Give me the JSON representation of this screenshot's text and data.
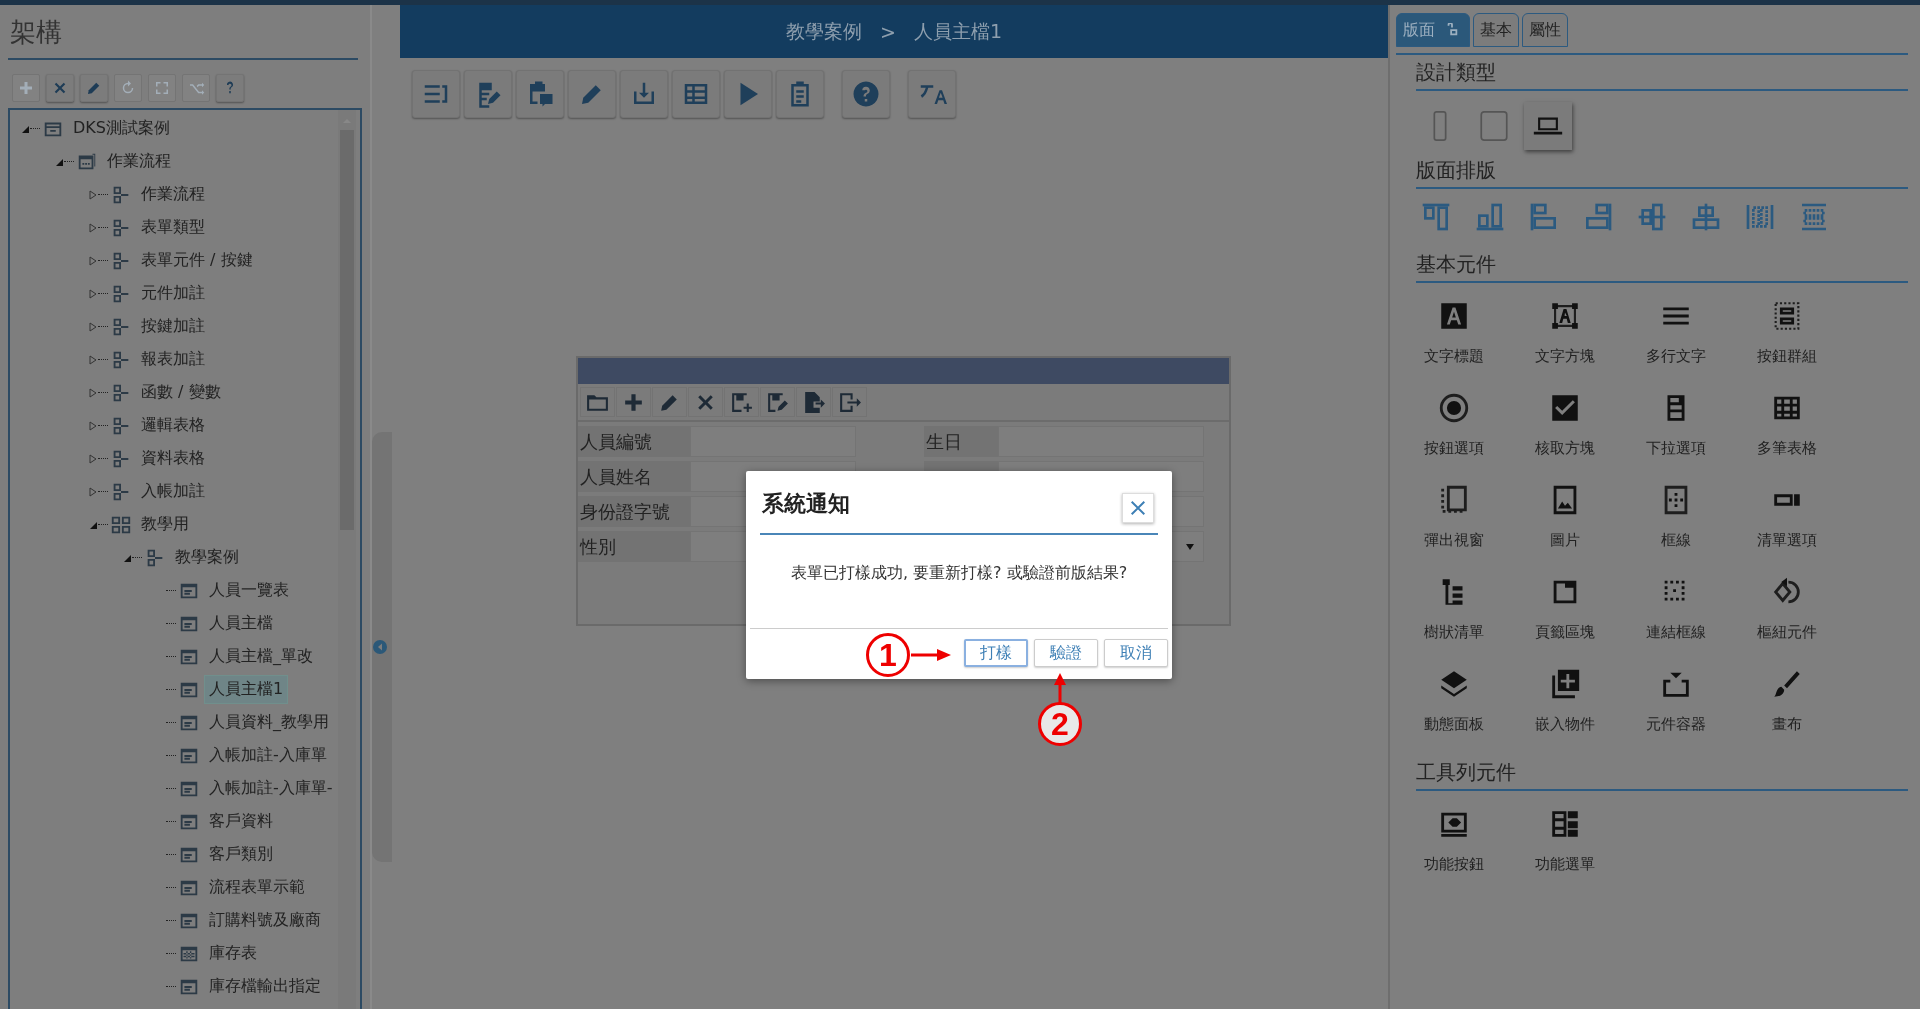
{
  "left_panel": {
    "title": "架構",
    "toolbar": [
      {
        "kind": "add",
        "disabled": true
      },
      {
        "kind": "delete",
        "disabled": false
      },
      {
        "kind": "edit",
        "disabled": false
      },
      {
        "kind": "refresh",
        "disabled": true
      },
      {
        "kind": "expand",
        "disabled": true
      },
      {
        "kind": "shuffle",
        "disabled": true
      },
      {
        "kind": "help",
        "disabled": false
      }
    ],
    "tree": [
      {
        "label": "DKS測試案例",
        "kind": "root",
        "expanded": true,
        "selected": false,
        "children": [
          {
            "label": "作業流程",
            "kind": "flow",
            "expanded": true,
            "selected": false,
            "children": [
              {
                "label": "作業流程",
                "kind": "node",
                "expanded": false,
                "selected": false
              },
              {
                "label": "表單類型",
                "kind": "node",
                "expanded": false,
                "selected": false
              },
              {
                "label": "表單元件 / 按鍵",
                "kind": "node",
                "expanded": false,
                "selected": false
              },
              {
                "label": "元件加註",
                "kind": "node",
                "expanded": false,
                "selected": false
              },
              {
                "label": "按鍵加註",
                "kind": "node",
                "expanded": false,
                "selected": false
              },
              {
                "label": "報表加註",
                "kind": "node",
                "expanded": false,
                "selected": false
              },
              {
                "label": "函數 / 變數",
                "kind": "node",
                "expanded": false,
                "selected": false
              },
              {
                "label": "邏輯表格",
                "kind": "node",
                "expanded": false,
                "selected": false
              },
              {
                "label": "資料表格",
                "kind": "node",
                "expanded": false,
                "selected": false
              },
              {
                "label": "入帳加註",
                "kind": "node",
                "expanded": false,
                "selected": false
              },
              {
                "label": "教學用",
                "kind": "group",
                "expanded": true,
                "selected": false,
                "children": [
                  {
                    "label": "教學案例",
                    "kind": "node",
                    "expanded": true,
                    "selected": false,
                    "children": [
                      {
                        "label": "人員一覽表",
                        "kind": "form",
                        "selected": false
                      },
                      {
                        "label": "人員主檔",
                        "kind": "form",
                        "selected": false
                      },
                      {
                        "label": "人員主檔_單改",
                        "kind": "form",
                        "selected": false
                      },
                      {
                        "label": "人員主檔1",
                        "kind": "form",
                        "selected": true
                      },
                      {
                        "label": "人員資料_教學用",
                        "kind": "form",
                        "selected": false
                      },
                      {
                        "label": "入帳加註-入庫單",
                        "kind": "form",
                        "selected": false
                      },
                      {
                        "label": "入帳加註-入庫單-",
                        "kind": "form",
                        "selected": false
                      },
                      {
                        "label": "客戶資料",
                        "kind": "form",
                        "selected": false
                      },
                      {
                        "label": "客戶類別",
                        "kind": "form",
                        "selected": false
                      },
                      {
                        "label": "流程表單示範",
                        "kind": "form",
                        "selected": false
                      },
                      {
                        "label": "訂購料號及廠商",
                        "kind": "form",
                        "selected": false
                      },
                      {
                        "label": "庫存表",
                        "kind": "table",
                        "selected": false
                      },
                      {
                        "label": "庫存檔輸出指定",
                        "kind": "form",
                        "selected": false
                      }
                    ]
                  }
                ]
              }
            ]
          }
        ]
      }
    ]
  },
  "breadcrumb": {
    "items": [
      "教學案例",
      "人員主檔1"
    ],
    "separator": ">"
  },
  "toolbar": [
    {
      "kind": "list-arrow"
    },
    {
      "kind": "edit-doc"
    },
    {
      "kind": "clipboard-chat"
    },
    {
      "kind": "pencil"
    },
    {
      "kind": "download"
    },
    {
      "kind": "table"
    },
    {
      "kind": "play"
    },
    {
      "kind": "clipboard"
    },
    {
      "kind": "help-circle"
    },
    {
      "kind": "translate"
    }
  ],
  "form": {
    "toolbar": [
      {
        "kind": "folder"
      },
      {
        "kind": "add"
      },
      {
        "kind": "pencil"
      },
      {
        "kind": "delete"
      },
      {
        "kind": "save-add"
      },
      {
        "kind": "save-edit"
      },
      {
        "kind": "export"
      },
      {
        "kind": "exit"
      }
    ],
    "rows": [
      {
        "label": "人員編號",
        "side_label": "生日",
        "side_dropdown": false
      },
      {
        "label": "人員姓名",
        "side_dropdown": false
      },
      {
        "label": "身份證字號",
        "side_dropdown": false
      },
      {
        "label": "性別",
        "side_dropdown": true
      }
    ]
  },
  "dialog": {
    "title": "系統通知",
    "message": "表單已打樣成功, 要重新打樣? 或驗證前版結果?",
    "buttons": [
      {
        "label": "打樣",
        "selected": true
      },
      {
        "label": "驗證",
        "selected": false
      },
      {
        "label": "取消",
        "selected": false
      }
    ]
  },
  "annotations": [
    {
      "number": "1"
    },
    {
      "number": "2"
    }
  ],
  "right_panel": {
    "tabs": [
      {
        "label": "版面",
        "selected": true,
        "locked": true
      },
      {
        "label": "基本",
        "selected": false,
        "locked": false
      },
      {
        "label": "屬性",
        "selected": false,
        "locked": false
      }
    ],
    "design_type": {
      "title": "設計類型",
      "devices": [
        {
          "kind": "phone",
          "selected": false
        },
        {
          "kind": "tablet",
          "selected": false
        },
        {
          "kind": "laptop",
          "selected": true
        }
      ]
    },
    "layout": {
      "title": "版面排版",
      "tools": [
        {
          "kind": "align-top"
        },
        {
          "kind": "align-bottom"
        },
        {
          "kind": "align-left"
        },
        {
          "kind": "align-right"
        },
        {
          "kind": "center-v"
        },
        {
          "kind": "center-h"
        },
        {
          "kind": "distribute-h"
        },
        {
          "kind": "distribute-v"
        }
      ]
    },
    "basic": {
      "title": "基本元件",
      "items": [
        {
          "label": "文字標題",
          "kind": "letter-a"
        },
        {
          "label": "文字方塊",
          "kind": "text-frame"
        },
        {
          "label": "多行文字",
          "kind": "lines"
        },
        {
          "label": "按鈕群組",
          "kind": "dotted-frame"
        },
        {
          "label": "按鈕選項",
          "kind": "radio"
        },
        {
          "label": "核取方塊",
          "kind": "checkbox"
        },
        {
          "label": "下拉選項",
          "kind": "dropdown-list"
        },
        {
          "label": "多筆表格",
          "kind": "table-grid"
        },
        {
          "label": "彈出視窗",
          "kind": "dotted-window"
        },
        {
          "label": "圖片",
          "kind": "image"
        },
        {
          "label": "框線",
          "kind": "dotted-box"
        },
        {
          "label": "清單選項",
          "kind": "spinner-box"
        },
        {
          "label": "樹狀清單",
          "kind": "tree"
        },
        {
          "label": "頁籤區塊",
          "kind": "page-tab"
        },
        {
          "label": "連結框線",
          "kind": "dot-grid"
        },
        {
          "label": "樞紐元件",
          "kind": "rotate-diamond"
        },
        {
          "label": "動態面板",
          "kind": "layers"
        },
        {
          "label": "嵌入物件",
          "kind": "add-stack"
        },
        {
          "label": "元件容器",
          "kind": "container"
        },
        {
          "label": "畫布",
          "kind": "brush"
        }
      ]
    },
    "toolbar_items": {
      "title": "工具列元件",
      "items": [
        {
          "label": "功能按鈕",
          "kind": "screen-button"
        },
        {
          "label": "功能選單",
          "kind": "menu-list"
        }
      ]
    }
  }
}
